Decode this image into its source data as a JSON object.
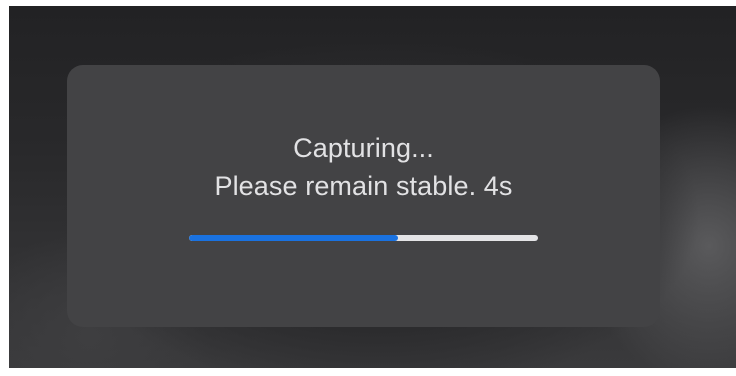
{
  "hud": {
    "title": "Capturing...",
    "message": "Please remain stable. 4s"
  },
  "progress": {
    "value": 0.6,
    "fill_color": "#1a72e0",
    "track_color": "#e4e4e6"
  }
}
